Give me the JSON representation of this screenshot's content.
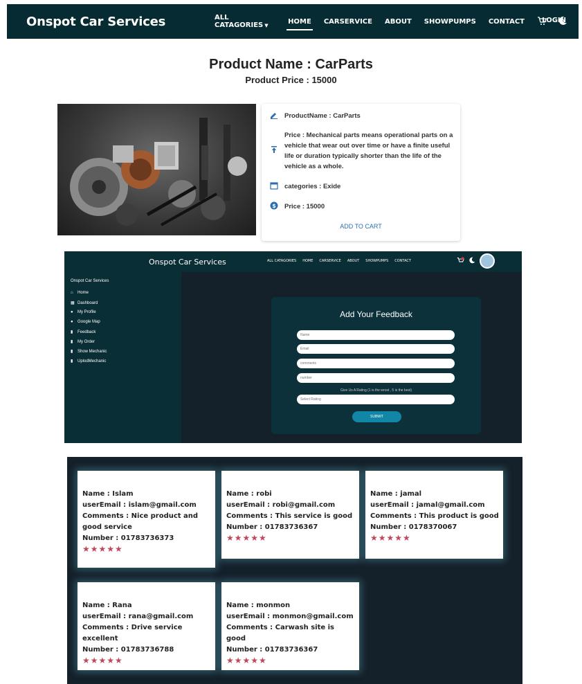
{
  "nav": {
    "brand": "Onspot Car Services",
    "links": [
      "ALL CATAGORIES",
      "HOME",
      "CARSERVICE",
      "ABOUT",
      "SHOWPUMPS",
      "CONTACT"
    ],
    "login": "LOGIN",
    "icons": [
      "cart-icon",
      "moon-icon"
    ]
  },
  "product": {
    "title": "Product Name : CarParts",
    "price_heading": "Product Price : 15000",
    "name_line": "ProductName : CarParts",
    "description": "Price : Mechanical parts means operational parts on a vehicle that wear out over time or have a finite useful life or duration typically shorter than the life of the vehicle as a whole.",
    "category": "categories : Exide",
    "price_line": "Price : 15000",
    "add_to_cart": "ADD TO CART"
  },
  "dashboard": {
    "brand": "Onspot Car Services",
    "links": [
      "ALL CATAGORIES",
      "HOME",
      "CARSERVICE",
      "ABOUT",
      "SHOWPUMPS",
      "CONTACT"
    ],
    "sidebar_title": "Onspot Car Services",
    "sidebar_items": [
      "Home",
      "Dashboard",
      "My Profile",
      "Google Map",
      "Feedback",
      "My Order",
      "Show Mechanic",
      "UplodMechanic"
    ],
    "form_title": "Add Your Feedback",
    "placeholders": {
      "name": "Name",
      "email": "Email",
      "comments": "comments",
      "number": "number",
      "rating": "Select Rating"
    },
    "rating_note": "Give Us A Rating (1 is the wrost , 5 is the best)",
    "submit": "SUBMIT"
  },
  "feedback": [
    {
      "name": "Name : Islam",
      "email": "userEmail : islam@gmail.com",
      "comments": "Comments : Nice product and good service",
      "number": "Number : 01783736373",
      "stars": "★★★★★"
    },
    {
      "name": "Name : robi",
      "email": "userEmail : robi@gmail.com",
      "comments": "Comments : This service is good",
      "number": "Number : 01783736367",
      "stars": "★★★★★"
    },
    {
      "name": "Name : jamal",
      "email": "userEmail : jamal@gmail.com",
      "comments": "Comments : This product is good",
      "number": "Number : 0178370067",
      "stars": "★★★★★"
    },
    {
      "name": "Name : Rana",
      "email": "userEmail : rana@gmail.com",
      "comments": "Comments : Drive service excellent",
      "number": "Number : 01783736788",
      "stars": "★★★★★"
    },
    {
      "name": "Name : monmon",
      "email": "userEmail : monmon@gmail.com",
      "comments": "Comments : Carwash site is good",
      "number": "Number : 01783736367",
      "stars": "★★★★★"
    }
  ],
  "colors": {
    "nav_bg": "#062b33",
    "dark_bg": "#14202a",
    "accent": "#1286a6",
    "star": "#c0475a"
  }
}
